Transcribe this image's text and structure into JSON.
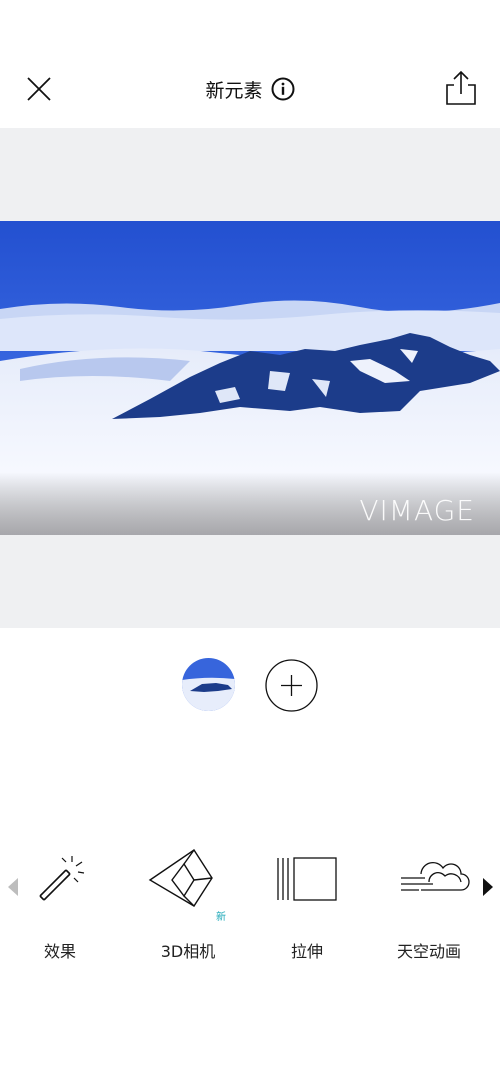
{
  "header": {
    "title": "新元素"
  },
  "preview": {
    "watermark": "VIMAGE"
  },
  "tools": [
    {
      "label": "效果",
      "icon": "magic-wand-icon"
    },
    {
      "label": "3D相机",
      "icon": "3d-camera-icon",
      "badge": "新"
    },
    {
      "label": "拉伸",
      "icon": "stretch-icon"
    },
    {
      "label": "天空动画",
      "icon": "sky-cloud-icon"
    }
  ],
  "colors": {
    "sky": "#2a57d6",
    "mountain": "#1c3c8a",
    "badge": "#1aa7b7"
  }
}
